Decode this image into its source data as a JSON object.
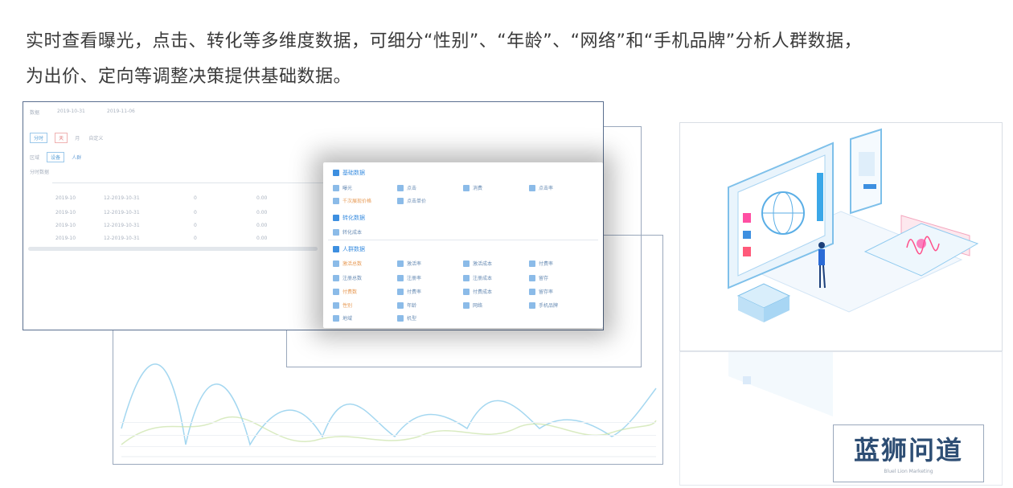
{
  "intro": {
    "line1": "实时查看曝光，点击、转化等多维度数据，可细分“性别”、“年龄”、“网络”和“手机品牌”分析人群数据，",
    "line2": "为出价、定向等调整决策提供基础数据。"
  },
  "back_panel": {
    "title": "数据",
    "date_from": "2019-10-31",
    "date_to": "2019-11-06",
    "filter_chips": [
      "分时",
      "天",
      "月",
      "自定义"
    ],
    "sub_chips": [
      "区域",
      "设备",
      "人群"
    ],
    "section_label": "分时数据",
    "rows": [
      {
        "a": "2019-10",
        "b": "12-2019-10-31",
        "c": "0",
        "d": "0.00"
      },
      {
        "a": "2019-10",
        "b": "12-2019-10-31",
        "c": "0",
        "d": "0.00"
      },
      {
        "a": "2019-10",
        "b": "12-2019-10-31",
        "c": "0",
        "d": "0.00"
      },
      {
        "a": "2019-10",
        "b": "12-2019-10-31",
        "c": "0",
        "d": "0.00"
      }
    ]
  },
  "popup": {
    "section1": {
      "title": "基础数据",
      "items": [
        "曝光",
        "点击",
        "消费",
        "点击率",
        "千次展现价格",
        "点击单价"
      ]
    },
    "section2": {
      "title": "转化数据",
      "items": [
        "转化成本"
      ]
    },
    "section3": {
      "title": "人群数据",
      "items": [
        "激活总数",
        "激活率",
        "激活成本",
        "付费率",
        "注册总数",
        "注册率",
        "注册成本",
        "留存",
        "付费数",
        "付费率",
        "付费成本",
        "留存率",
        "性别",
        "年龄",
        "网络",
        "手机品牌",
        "地域",
        "机型"
      ]
    }
  },
  "colors": {
    "accent": "#3d8fe0",
    "panel_border": "#5a6f8f",
    "chart_line_a": "#7ec6ea",
    "chart_line_b": "#c9e2a6"
  },
  "logo": {
    "name": "蓝狮问道",
    "tagline": "Bluel Lion Marketing"
  }
}
